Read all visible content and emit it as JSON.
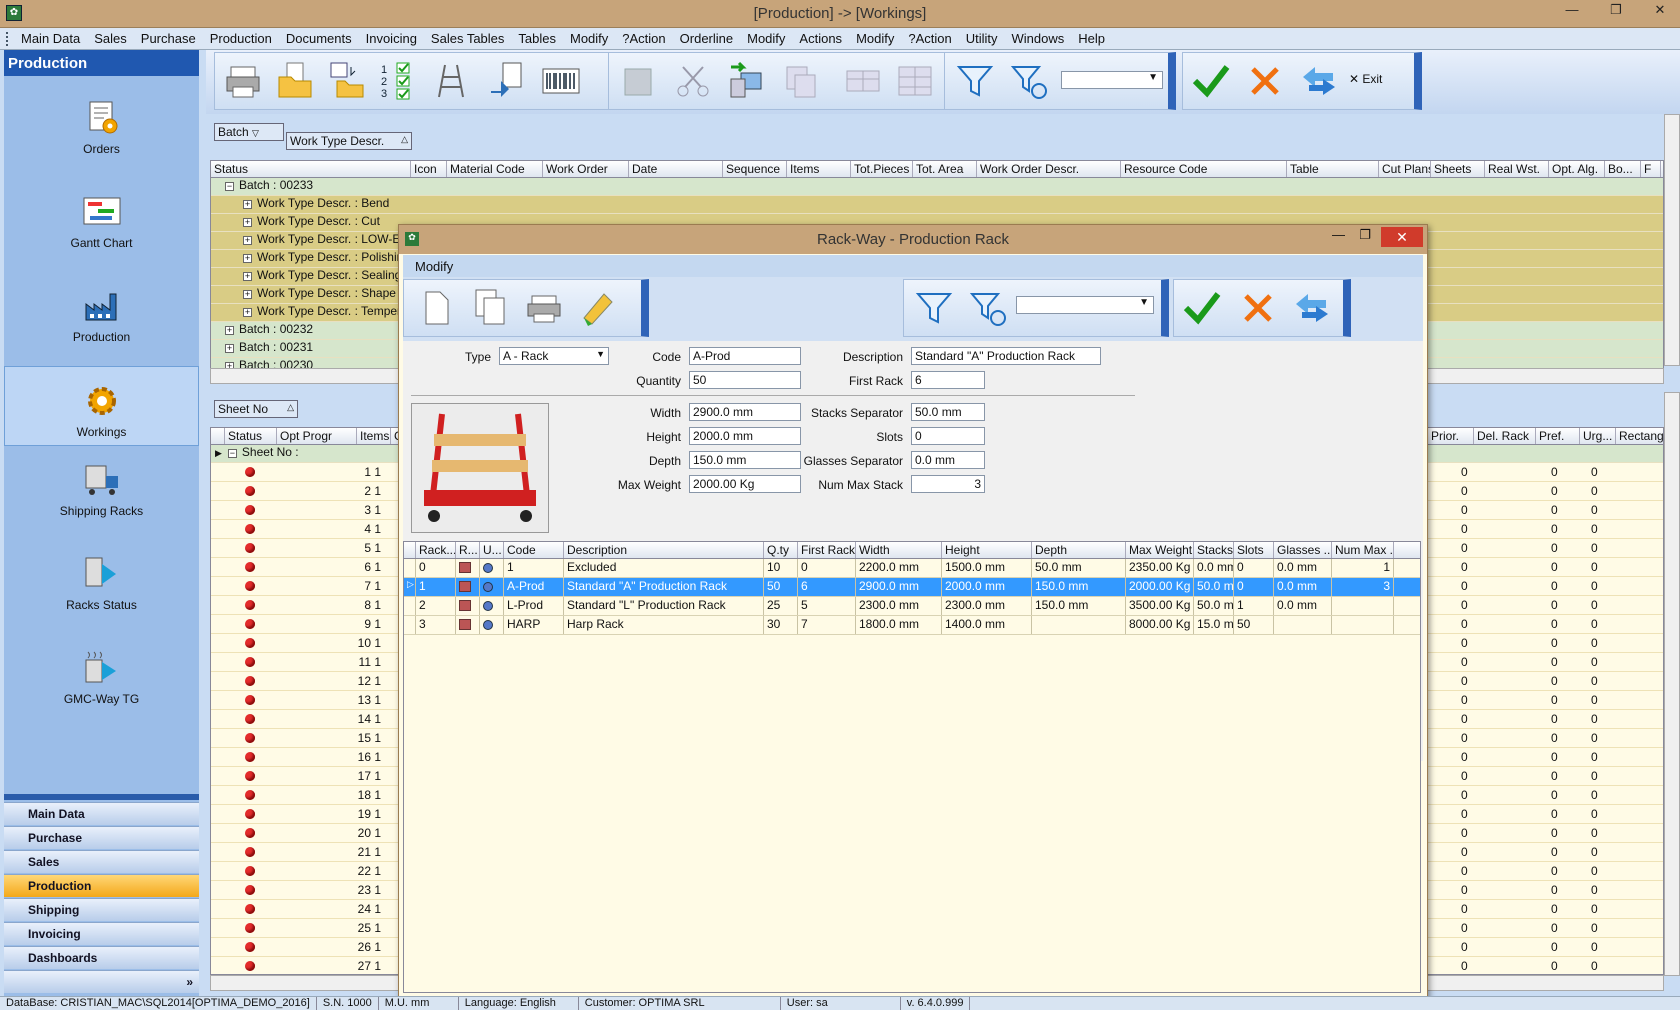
{
  "window": {
    "title": "[Production] -> [Workings]"
  },
  "menu": [
    "Main Data",
    "Sales",
    "Purchase",
    "Production",
    "Documents",
    "Invoicing",
    "Sales Tables",
    "Tables",
    "Modify",
    "?Action",
    "Orderline",
    "Modify",
    "Actions",
    "Modify",
    "?Action",
    "Utility",
    "Windows",
    "Help"
  ],
  "sidebar": {
    "title": "Production",
    "items": [
      "Orders",
      "Gantt Chart",
      "Production",
      "Workings",
      "Shipping Racks",
      "Racks Status",
      "GMC-Way TG"
    ],
    "nav": [
      "Main Data",
      "Purchase",
      "Sales",
      "Production",
      "Shipping",
      "Invoicing",
      "Dashboards"
    ]
  },
  "toolbar": {
    "exit_label": "Exit"
  },
  "groups": {
    "batch": "Batch",
    "worktype": "Work Type Descr.",
    "sheet": "Sheet No"
  },
  "grid1": {
    "headers": [
      "Status",
      "Icon",
      "Material Code",
      "Work Order",
      "Date",
      "Sequence",
      "Items",
      "Tot.Pieces",
      "Tot. Area",
      "Work Order Descr.",
      "Resource Code",
      "Table",
      "Cut Plans",
      "Sheets",
      "Real Wst.",
      "Opt. Alg.",
      "Bo...",
      "F"
    ],
    "rows": [
      {
        "kind": "batch",
        "text": "Batch : 00233",
        "exp": "−"
      },
      {
        "kind": "wt",
        "text": "Work Type Descr. : Bend",
        "exp": "+"
      },
      {
        "kind": "wt",
        "text": "Work Type Descr. : Cut",
        "exp": "+"
      },
      {
        "kind": "wt",
        "text": "Work Type Descr. : LOW-E E",
        "exp": "+"
      },
      {
        "kind": "wt",
        "text": "Work Type Descr. : Polishing",
        "exp": "+"
      },
      {
        "kind": "wt",
        "text": "Work Type Descr. : Sealing G",
        "exp": "+"
      },
      {
        "kind": "wt",
        "text": "Work Type Descr. : Shape P",
        "exp": "+"
      },
      {
        "kind": "wt",
        "text": "Work Type Descr. : Temper",
        "exp": "+"
      },
      {
        "kind": "batch",
        "text": "Batch : 00232",
        "exp": "+"
      },
      {
        "kind": "batch",
        "text": "Batch : 00231",
        "exp": "+"
      },
      {
        "kind": "batch",
        "text": "Batch : 00230",
        "exp": "+"
      }
    ]
  },
  "grid2": {
    "headers_left": [
      "Status",
      "Opt Progr",
      "Items",
      "C"
    ],
    "headers_right": [
      "Prior.",
      "Del. Rack",
      "Pref.",
      "Urg...",
      "Rectangle Y/N"
    ],
    "group_row": "Sheet No :",
    "rows": [
      "1 1",
      "2 1",
      "3 1",
      "4 1",
      "5 1",
      "6 1",
      "7 1",
      "8 1",
      "9 1",
      "10 1",
      "11 1",
      "12 1",
      "13 1",
      "14 1",
      "15 1",
      "16 1",
      "17 1",
      "18 1",
      "19 1",
      "20 1",
      "21 1",
      "22 1",
      "23 1",
      "24 1",
      "25 1",
      "26 1",
      "27 1"
    ],
    "zero": "0"
  },
  "modal": {
    "title": "Rack-Way - Production Rack",
    "menu": "Modify",
    "form": {
      "type_label": "Type",
      "type_value": "A - Rack",
      "code_label": "Code",
      "code_value": "A-Prod",
      "desc_label": "Description",
      "desc_value": "Standard \"A\" Production Rack",
      "qty_label": "Quantity",
      "qty_value": "50",
      "first_label": "First Rack",
      "first_value": "6",
      "width_label": "Width",
      "width_value": "2900.0 mm",
      "height_label": "Height",
      "height_value": "2000.0 mm",
      "depth_label": "Depth",
      "depth_value": "150.0 mm",
      "maxw_label": "Max Weight",
      "maxw_value": "2000.00 Kg",
      "stacks_label": "Stacks Separator",
      "stacks_value": "50.0 mm",
      "slots_label": "Slots",
      "slots_value": "0",
      "glass_label": "Glasses Separator",
      "glass_value": "0.0 mm",
      "nummax_label": "Num Max Stack",
      "nummax_value": "3"
    },
    "grid": {
      "headers": [
        "Rack...",
        "R...",
        "U...",
        "Code",
        "Description",
        "Q.ty",
        "First Rack",
        "Width",
        "Height",
        "Depth",
        "Max Weight",
        "Stacks S...",
        "Slots",
        "Glasses ...",
        "Num Max ..."
      ],
      "rows": [
        [
          "0",
          "",
          "",
          "1",
          "Excluded",
          "10",
          "0",
          "2200.0 mm",
          "1500.0 mm",
          "50.0 mm",
          "2350.00 Kg",
          "0.0 mm",
          "0",
          "0.0 mm",
          "1"
        ],
        [
          "1",
          "",
          "",
          "A-Prod",
          "Standard \"A\" Production Rack",
          "50",
          "6",
          "2900.0 mm",
          "2000.0 mm",
          "150.0 mm",
          "2000.00 Kg",
          "50.0 mm",
          "0",
          "0.0 mm",
          "3"
        ],
        [
          "2",
          "",
          "",
          "L-Prod",
          "Standard \"L\" Production Rack",
          "25",
          "5",
          "2300.0 mm",
          "2300.0 mm",
          "150.0 mm",
          "3500.00 Kg",
          "50.0 mm",
          "1",
          "0.0 mm",
          ""
        ],
        [
          "3",
          "",
          "",
          "HARP",
          "Harp Rack",
          "30",
          "7",
          "1800.0 mm",
          "1400.0 mm",
          "",
          "8000.00 Kg",
          "15.0 mm",
          "50",
          "",
          ""
        ]
      ]
    }
  },
  "status": [
    "DataBase: CRISTIAN_MAC\\SQL2014[OPTIMA_DEMO_2016]",
    "S.N. 1000",
    "M.U. mm",
    "Language: English",
    "Customer: OPTIMA SRL",
    "User: sa",
    "v. 6.4.0.999"
  ]
}
